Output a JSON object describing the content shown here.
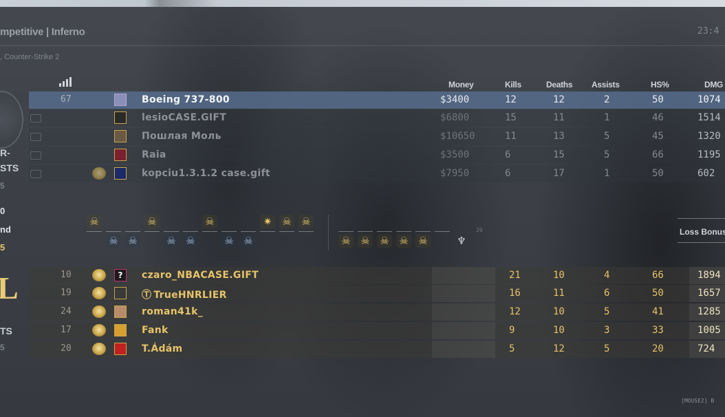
{
  "match": {
    "title": "mpetitive | Inferno",
    "clock": "23:4",
    "subtitle": ", Counter-Strike 2"
  },
  "columns": {
    "money": "Money",
    "kills": "Kills",
    "deaths": "Deaths",
    "assists": "Assists",
    "hs": "HS%",
    "dmg": "DMG"
  },
  "ct_side": {
    "team_label_1": "R-",
    "team_label_2": "STS",
    "team_sub": "5",
    "stat1": "0",
    "stat2": "nd",
    "stat3": "5",
    "players": [
      {
        "ping": "67",
        "name": "Boeing 737-800",
        "money": "$3400",
        "kills": "12",
        "deaths": "12",
        "assists": "2",
        "hs": "50",
        "dmg": "1074",
        "highlight": true,
        "dead": false,
        "avatar_color": "#8a8fb8"
      },
      {
        "ping": "",
        "name": "lesioCASE.GIFT",
        "money": "$6800",
        "kills": "15",
        "deaths": "11",
        "assists": "1",
        "hs": "46",
        "dmg": "1514",
        "highlight": false,
        "dead": true,
        "avatar_color": "#2a2a2a"
      },
      {
        "ping": "",
        "name": "Пошлая Моль",
        "money": "$10650",
        "kills": "11",
        "deaths": "13",
        "assists": "5",
        "hs": "45",
        "dmg": "1320",
        "highlight": false,
        "dead": true,
        "avatar_color": "#6a5a45"
      },
      {
        "ping": "",
        "name": "Raia",
        "money": "$3500",
        "kills": "6",
        "deaths": "15",
        "assists": "5",
        "hs": "66",
        "dmg": "1195",
        "highlight": false,
        "dead": true,
        "avatar_color": "#7a2030"
      },
      {
        "ping": "",
        "name": "kopciu1.3.1.2 case.gift",
        "money": "$7950",
        "kills": "6",
        "deaths": "17",
        "assists": "1",
        "hs": "50",
        "dmg": "602",
        "highlight": false,
        "dead": true,
        "avatar_color": "#1a2a6a"
      }
    ]
  },
  "t_side": {
    "team_letter": "L",
    "team_label": "TS",
    "team_sub": "5",
    "players": [
      {
        "ping": "10",
        "name": "czaro_NBACASE.GIFT",
        "kills": "21",
        "deaths": "10",
        "assists": "4",
        "hs": "66",
        "dmg": "1894",
        "avatar_text": "?",
        "avatar_color": "#1a1a1a"
      },
      {
        "ping": "19",
        "name": "TrueHNRLIER",
        "prefix_icon": "Ⓣ",
        "kills": "16",
        "deaths": "11",
        "assists": "6",
        "hs": "50",
        "dmg": "1657",
        "avatar_text": "",
        "avatar_color": "#3a3a3a"
      },
      {
        "ping": "24",
        "name": "roman41k_",
        "kills": "12",
        "deaths": "10",
        "assists": "5",
        "hs": "41",
        "dmg": "1285",
        "avatar_text": "",
        "avatar_color": "#b88c6a"
      },
      {
        "ping": "17",
        "name": "Fank",
        "kills": "9",
        "deaths": "10",
        "assists": "3",
        "hs": "33",
        "dmg": "1005",
        "avatar_text": "",
        "avatar_color": "#d6a030"
      },
      {
        "ping": "20",
        "name": "T.Ádám",
        "kills": "5",
        "deaths": "12",
        "assists": "5",
        "hs": "20",
        "dmg": "724",
        "avatar_text": "",
        "avatar_color": "#c02020"
      }
    ]
  },
  "rounds": {
    "loss_bonus_label": "Loss Bonus",
    "round_number_label": "20"
  },
  "footer": {
    "hint": "[MOUSE2] B"
  },
  "colors": {
    "t_text": "#e6c36a",
    "ct_text": "#dfe4ea",
    "ct_dim": "#8e9398",
    "highlight_row": "#566c8c"
  }
}
